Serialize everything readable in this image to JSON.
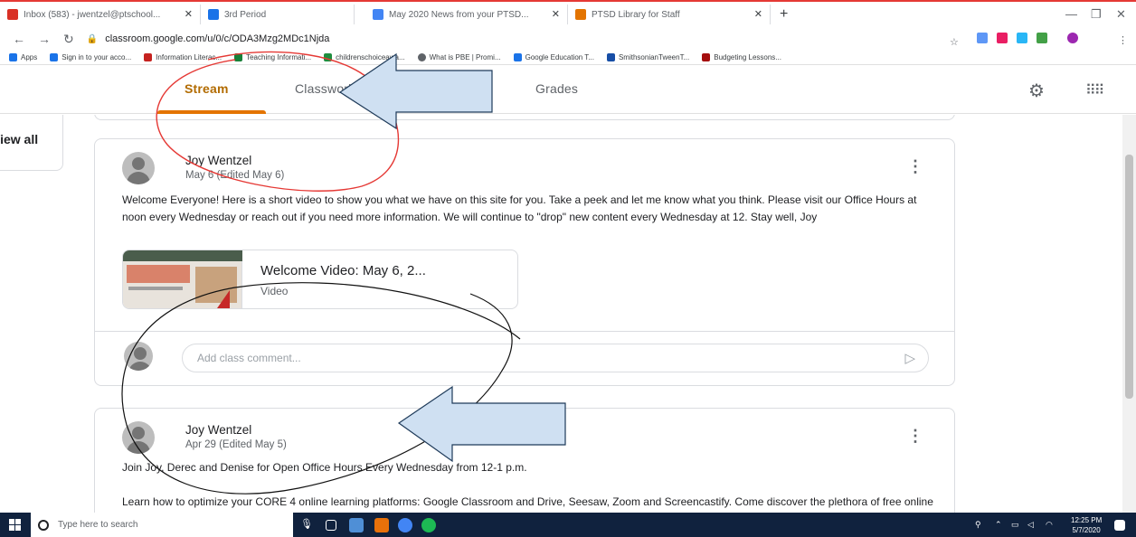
{
  "browser": {
    "tabs": [
      {
        "label": "Inbox (583) - jwentzel@ptschool...",
        "favicon_color": "#d93025"
      },
      {
        "label": "3rd Period",
        "favicon_color": "#1a73e8"
      },
      {
        "label": "May 2020 News from your PTSD...",
        "favicon_color": "#4285f4"
      },
      {
        "label": "PTSD Library for Staff",
        "favicon_color": "#e37400"
      }
    ],
    "new_tab_glyph": "+",
    "url": "classroom.google.com/u/0/c/ODA3Mzg2MDc1Njda",
    "bookmarks": [
      {
        "label": "Apps",
        "color": "#1a73e8"
      },
      {
        "label": "Sign in to your acco...",
        "color": "#1a73e8"
      },
      {
        "label": "Information Literac...",
        "color": "#c5221f"
      },
      {
        "label": "Teaching Informati...",
        "color": "#188038"
      },
      {
        "label": "childrenschoiceawa...",
        "color": "#1e8e3e"
      },
      {
        "label": "What is PBE | Promi...",
        "color": "#5f6368"
      },
      {
        "label": "Google Education T...",
        "color": "#1a73e8"
      },
      {
        "label": "SmithsonianTweenT...",
        "color": "#174ea6"
      },
      {
        "label": "Budgeting Lessons...",
        "color": "#a50e0e"
      }
    ]
  },
  "classroom": {
    "tabs": [
      {
        "label": "Stream",
        "active": true
      },
      {
        "label": "Classwork",
        "active": false
      },
      {
        "label": "Grades",
        "active": false
      }
    ],
    "accent_color": "#e37400",
    "settings_icon": "gear-icon",
    "apps_icon": "apps-grid-icon"
  },
  "left_panel": {
    "view_all_label": "View all"
  },
  "posts": [
    {
      "author": "Joy Wentzel",
      "date": "May 6 (Edited May 6)",
      "text": "Welcome Everyone! Here is a short video to show you what we have on this site for you. Take a peek and let me know what you think. Please visit our Office Hours at noon every Wednesday or reach out if you need more information. We will continue to \"drop\" new content every Wednesday at 12. Stay well, Joy",
      "attachment": {
        "title": "Welcome Video: May 6, 2...",
        "type": "Video"
      },
      "comment_placeholder": "Add class comment..."
    },
    {
      "author": "Joy Wentzel",
      "date": "Apr 29 (Edited May 5)",
      "text_line1": "Join Joy, Derec and Denise for Open Office Hours Every Wednesday from 12-1 p.m.",
      "text_line2": "Learn how to optimize your CORE 4 online learning platforms: Google Classroom and Drive, Seesaw, Zoom and Screencastify. Come discover the plethora of free online databases and resources that your library card offers you."
    }
  ],
  "taskbar": {
    "search_placeholder": "Type here to search",
    "time": "12:25 PM",
    "date": "5/7/2020"
  },
  "annotations": {
    "arrow_fill": "#cfe0f2",
    "arrow_stroke": "#1f3b5a",
    "red_ink": "#e53935",
    "black_ink": "#111111"
  }
}
